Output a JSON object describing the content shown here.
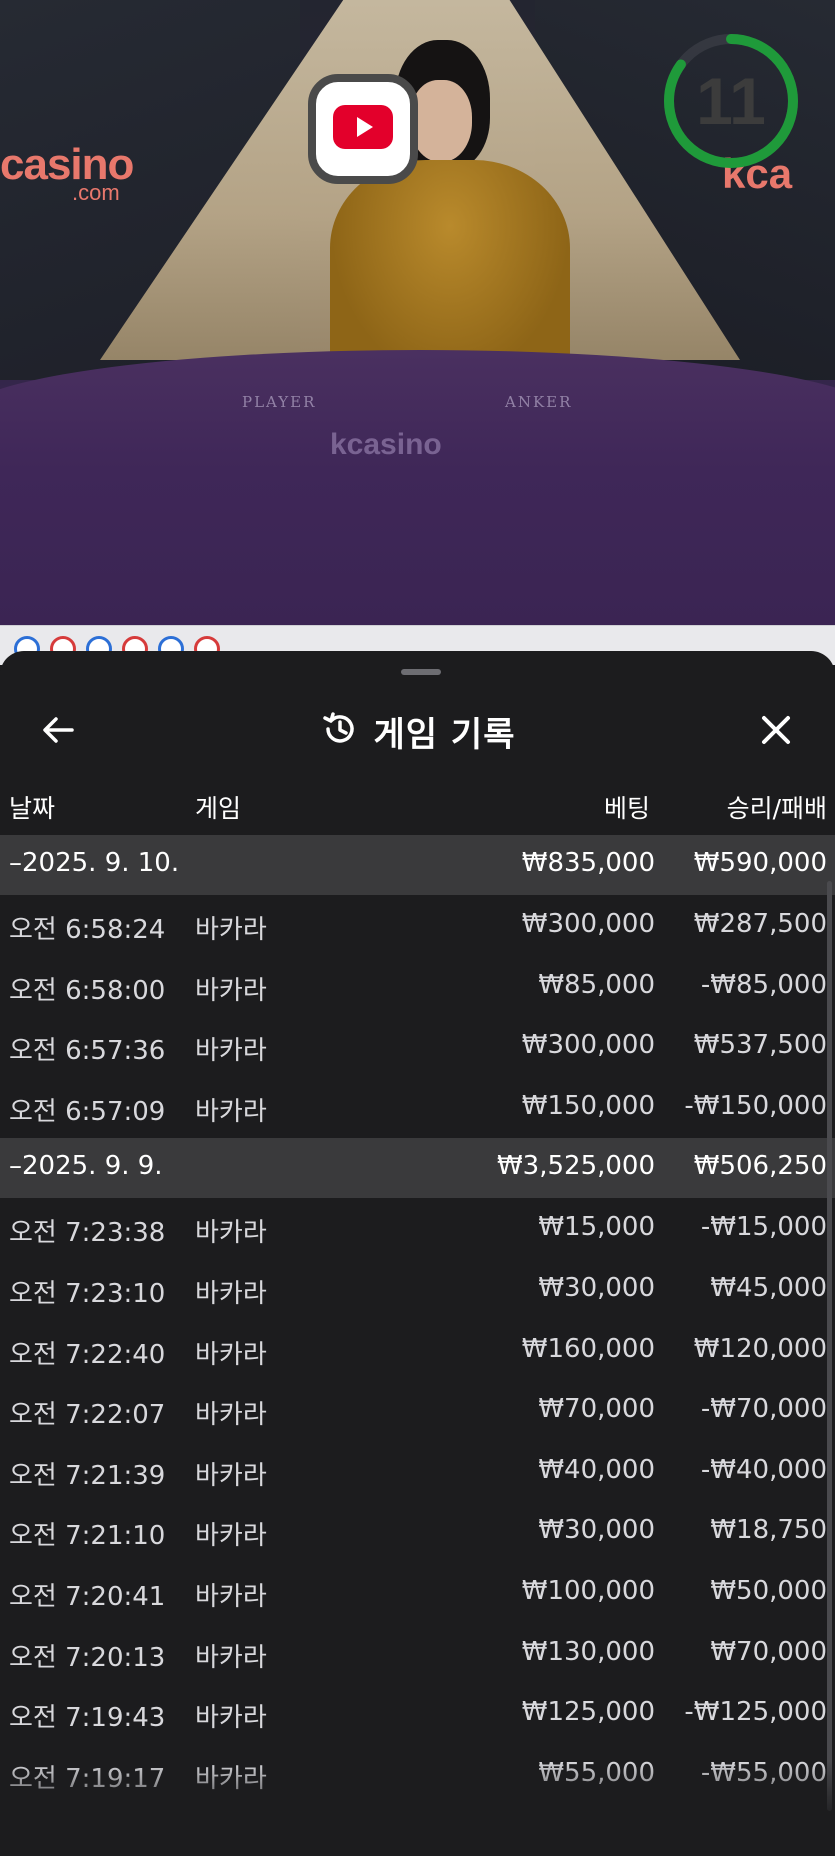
{
  "video": {
    "timer_value": "11",
    "timer_progress": 0.85,
    "brand_left": "casino",
    "brand_left_sub": ".com",
    "brand_right": "kca",
    "brand_center": "kcasino",
    "table_player_label": "PLAYER",
    "table_banker_label": "ANKER",
    "youtube_icon": "youtube-icon",
    "colors": {
      "timer_ring": "#1f9a3a",
      "youtube_red": "#e3002b"
    }
  },
  "sheet": {
    "title": "게임 기록",
    "title_icon": "history-icon",
    "back_icon": "arrow-left-icon",
    "close_icon": "close-icon",
    "columns": {
      "date": "날짜",
      "game": "게임",
      "bet": "베팅",
      "winloss": "승리/패배"
    }
  },
  "history": [
    {
      "date": "–2025. 9. 10.",
      "bet": "₩835,000",
      "winloss": "₩590,000",
      "entries": [
        {
          "time": "오전 6:58:24",
          "game": "바카라",
          "bet": "₩300,000",
          "winloss": "₩287,500"
        },
        {
          "time": "오전 6:58:00",
          "game": "바카라",
          "bet": "₩85,000",
          "winloss": "-₩85,000"
        },
        {
          "time": "오전 6:57:36",
          "game": "바카라",
          "bet": "₩300,000",
          "winloss": "₩537,500"
        },
        {
          "time": "오전 6:57:09",
          "game": "바카라",
          "bet": "₩150,000",
          "winloss": "-₩150,000"
        }
      ]
    },
    {
      "date": "–2025. 9. 9.",
      "bet": "₩3,525,000",
      "winloss": "₩506,250",
      "entries": [
        {
          "time": "오전 7:23:38",
          "game": "바카라",
          "bet": "₩15,000",
          "winloss": "-₩15,000"
        },
        {
          "time": "오전 7:23:10",
          "game": "바카라",
          "bet": "₩30,000",
          "winloss": "₩45,000"
        },
        {
          "time": "오전 7:22:40",
          "game": "바카라",
          "bet": "₩160,000",
          "winloss": "₩120,000"
        },
        {
          "time": "오전 7:22:07",
          "game": "바카라",
          "bet": "₩70,000",
          "winloss": "-₩70,000"
        },
        {
          "time": "오전 7:21:39",
          "game": "바카라",
          "bet": "₩40,000",
          "winloss": "-₩40,000"
        },
        {
          "time": "오전 7:21:10",
          "game": "바카라",
          "bet": "₩30,000",
          "winloss": "₩18,750"
        },
        {
          "time": "오전 7:20:41",
          "game": "바카라",
          "bet": "₩100,000",
          "winloss": "₩50,000"
        },
        {
          "time": "오전 7:20:13",
          "game": "바카라",
          "bet": "₩130,000",
          "winloss": "₩70,000"
        },
        {
          "time": "오전 7:19:43",
          "game": "바카라",
          "bet": "₩125,000",
          "winloss": "-₩125,000"
        },
        {
          "time": "오전 7:19:17",
          "game": "바카라",
          "bet": "₩55,000",
          "winloss": "-₩55,000"
        }
      ]
    }
  ]
}
